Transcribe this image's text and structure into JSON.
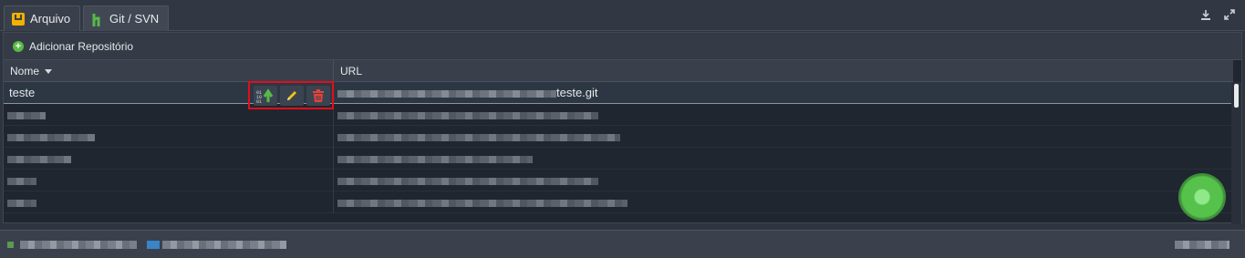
{
  "tabs": [
    {
      "label": "Arquivo",
      "icon": "archive-icon"
    },
    {
      "label": "Git / SVN",
      "icon": "git-branch-icon",
      "active": true
    }
  ],
  "toolbar": {
    "add_label": "Adicionar Repositório"
  },
  "columns": {
    "name": "Nome",
    "url": "URL"
  },
  "rows": [
    {
      "name": "teste",
      "url_visible": "teste.git",
      "selected": true
    },
    {
      "name": "",
      "url_visible": ""
    },
    {
      "name": "",
      "url_visible": ""
    },
    {
      "name": "",
      "url_visible": ""
    },
    {
      "name": "",
      "url_visible": ""
    },
    {
      "name": "",
      "url_visible": ""
    }
  ],
  "colors": {
    "accent_green": "#58b947",
    "highlight_red": "#e20e1a",
    "edit_yellow": "#f4c20d",
    "delete_red": "#e8423a"
  }
}
